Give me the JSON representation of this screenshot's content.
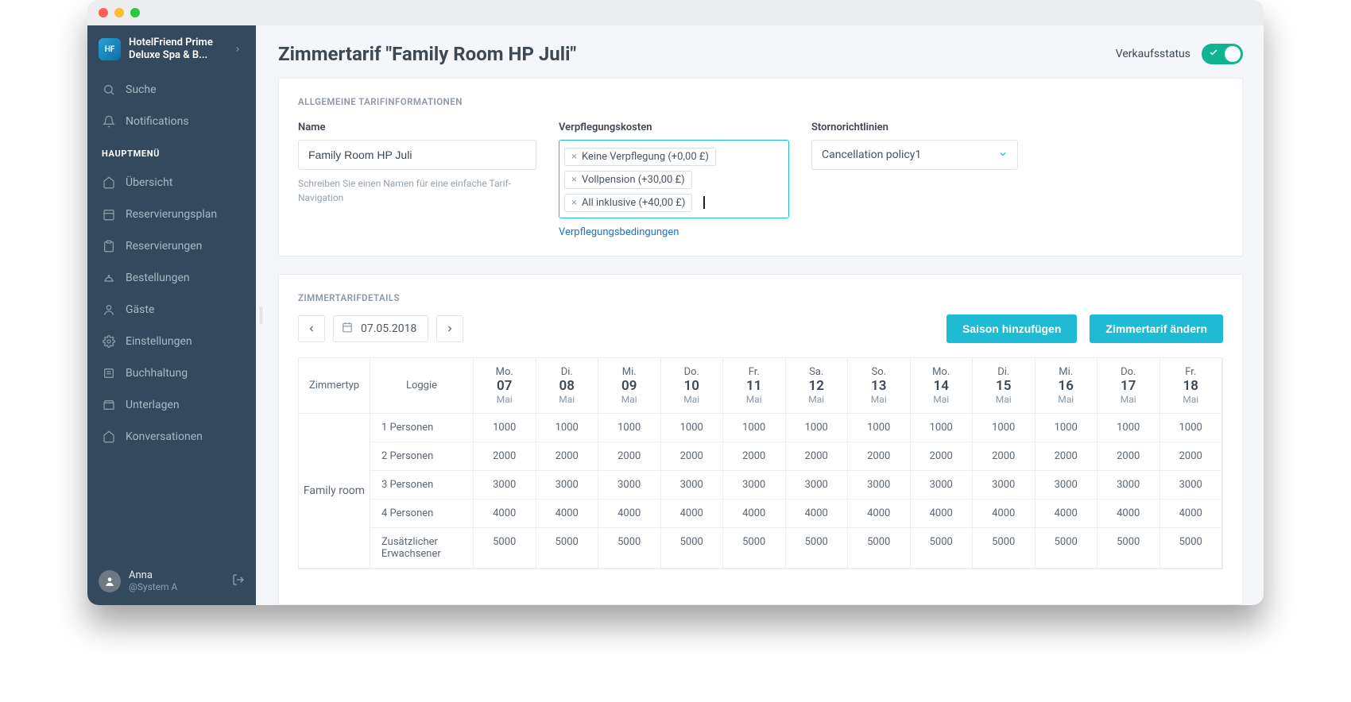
{
  "org": {
    "name": "HotelFriend Prime Deluxe Spa & B...",
    "logo_text": "HF"
  },
  "sidebar": {
    "search_label": "Suche",
    "notifications_label": "Notifications",
    "main_menu_header": "HAUPTMENÜ",
    "items": [
      {
        "label": "Übersicht",
        "icon": "home"
      },
      {
        "label": "Reservierungsplan",
        "icon": "calendar"
      },
      {
        "label": "Reservierungen",
        "icon": "clipboard"
      },
      {
        "label": "Bestellungen",
        "icon": "cloche"
      },
      {
        "label": "Gäste",
        "icon": "user"
      },
      {
        "label": "Einstellungen",
        "icon": "gear"
      },
      {
        "label": "Buchhaltung",
        "icon": "ledger"
      },
      {
        "label": "Unterlagen",
        "icon": "box"
      },
      {
        "label": "Konversationen",
        "icon": "chat"
      }
    ]
  },
  "user": {
    "name": "Anna",
    "handle": "@System A"
  },
  "header": {
    "title": "Zimmertarif \"Family Room HP Juli\"",
    "status_label": "Verkaufsstatus"
  },
  "panel1": {
    "title": "ALLGEMEINE TARIFINFORMATIONEN",
    "name_label": "Name",
    "name_value": "Family Room HP Juli",
    "name_help": "Schreiben Sie einen Namen für eine einfache Tarif-Navigation",
    "catering_label": "Verpflegungskosten",
    "chips": [
      "Keine Verpflegung (+0,00 £)",
      "Vollpension (+30,00 £)",
      "All inklusive (+40,00 £)"
    ],
    "catering_link": "Verpflegungsbedingungen",
    "cancel_label": "Stornorichtlinien",
    "cancel_value": "Cancellation policy1"
  },
  "panel2": {
    "title": "ZIMMERTARIFDETAILS",
    "date": "07.05.2018",
    "add_season": "Saison hinzufügen",
    "edit_tariff": "Zimmertarif ändern",
    "header_roomtype": "Zimmertyp",
    "header_loggie": "Loggie",
    "room_type": "Family room",
    "days": [
      {
        "wd": "Mo.",
        "d": "07",
        "m": "Mai"
      },
      {
        "wd": "Di.",
        "d": "08",
        "m": "Mai"
      },
      {
        "wd": "Mi.",
        "d": "09",
        "m": "Mai"
      },
      {
        "wd": "Do.",
        "d": "10",
        "m": "Mai"
      },
      {
        "wd": "Fr.",
        "d": "11",
        "m": "Mai"
      },
      {
        "wd": "Sa.",
        "d": "12",
        "m": "Mai"
      },
      {
        "wd": "So.",
        "d": "13",
        "m": "Mai"
      },
      {
        "wd": "Mo.",
        "d": "14",
        "m": "Mai"
      },
      {
        "wd": "Di.",
        "d": "15",
        "m": "Mai"
      },
      {
        "wd": "Mi.",
        "d": "16",
        "m": "Mai"
      },
      {
        "wd": "Do.",
        "d": "17",
        "m": "Mai"
      },
      {
        "wd": "Fr.",
        "d": "18",
        "m": "Mai"
      }
    ],
    "rows": [
      {
        "label": "1 Personen",
        "values": [
          1000,
          1000,
          1000,
          1000,
          1000,
          1000,
          1000,
          1000,
          1000,
          1000,
          1000,
          1000
        ]
      },
      {
        "label": "2 Personen",
        "values": [
          2000,
          2000,
          2000,
          2000,
          2000,
          2000,
          2000,
          2000,
          2000,
          2000,
          2000,
          2000
        ]
      },
      {
        "label": "3 Personen",
        "values": [
          3000,
          3000,
          3000,
          3000,
          3000,
          3000,
          3000,
          3000,
          3000,
          3000,
          3000,
          3000
        ]
      },
      {
        "label": "4 Personen",
        "values": [
          4000,
          4000,
          4000,
          4000,
          4000,
          4000,
          4000,
          4000,
          4000,
          4000,
          4000,
          4000
        ]
      },
      {
        "label": "Zusätzlicher Erwachsener",
        "values": [
          5000,
          5000,
          5000,
          5000,
          5000,
          5000,
          5000,
          5000,
          5000,
          5000,
          5000,
          5000
        ]
      }
    ]
  }
}
